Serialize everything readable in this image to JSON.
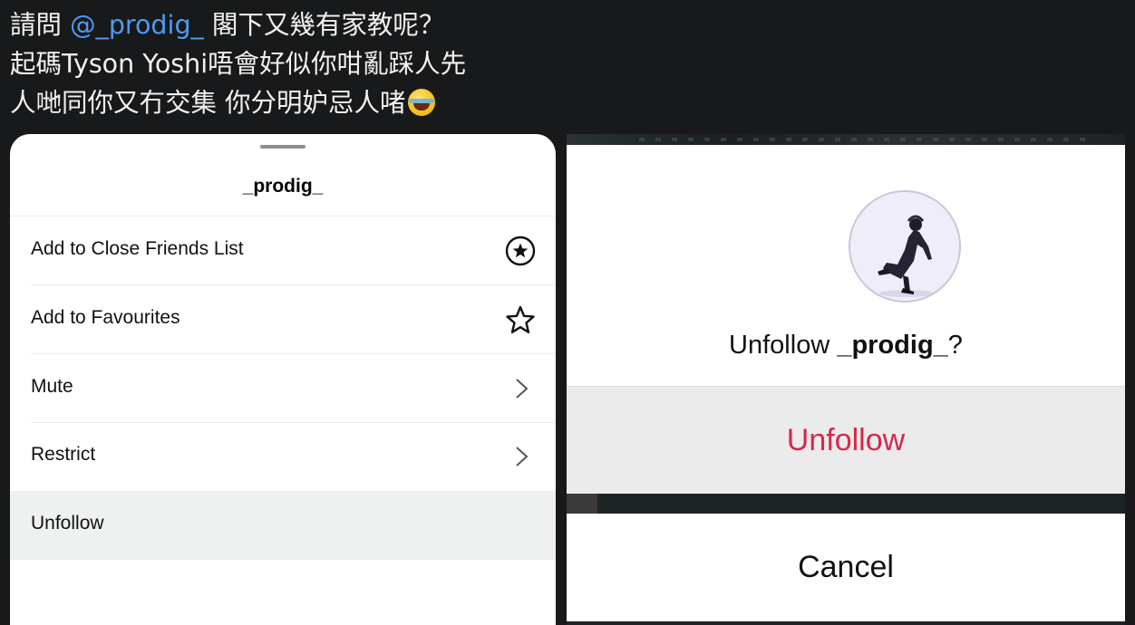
{
  "post": {
    "line1_prefix": "請問 ",
    "line1_mention": "@_prodig_",
    "line1_suffix": " 閣下又幾有家教呢？",
    "line2": "起碼Tyson Yoshi唔會好似你咁亂踩人先",
    "line3": "人哋同你又冇交集 你分明妒忌人啫",
    "emoji": "face-with-tears-of-joy"
  },
  "left_sheet": {
    "title": "_prodig_",
    "items": [
      {
        "label": "Add to Close Friends List",
        "icon": "star-circle-icon"
      },
      {
        "label": "Add to Favourites",
        "icon": "star-outline-icon"
      },
      {
        "label": "Mute",
        "icon": "chevron-right-icon"
      },
      {
        "label": "Restrict",
        "icon": "chevron-right-icon"
      },
      {
        "label": "Unfollow",
        "icon": ""
      }
    ]
  },
  "right_dialog": {
    "question_prefix": "Unfollow ",
    "question_user": "_prodig_",
    "question_suffix": "?",
    "unfollow_label": "Unfollow",
    "cancel_label": "Cancel",
    "unfollow_color": "#d5284d"
  }
}
